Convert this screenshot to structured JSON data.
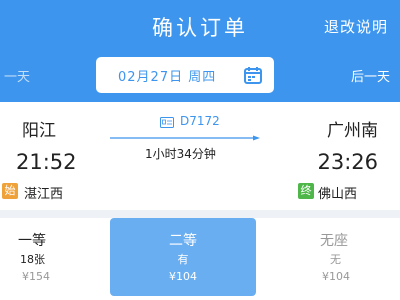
{
  "header": {
    "title": "确认订单",
    "refund_link": "退改说明",
    "prev_day": "一天",
    "next_day": "后一天",
    "date": "02月27日 周四"
  },
  "trip": {
    "departure_city": "阳江",
    "arrival_city": "广州南",
    "departure_time": "21:52",
    "arrival_time": "23:26",
    "train_no": "D7172",
    "duration": "1小时34分钟",
    "departure_badge": "始",
    "arrival_badge": "终",
    "departure_station": "湛江西",
    "arrival_station": "佛山西"
  },
  "seats": [
    {
      "name": "一等",
      "availability": "18张",
      "price": "¥154"
    },
    {
      "name": "二等",
      "availability": "有",
      "price": "¥104"
    },
    {
      "name": "无座",
      "availability": "无",
      "price": "¥104"
    }
  ],
  "colors": {
    "primary": "#3d95ee",
    "selected_seat": "#6aaef2",
    "origin_badge": "#f0a23a",
    "terminal_badge": "#4fb64a"
  }
}
